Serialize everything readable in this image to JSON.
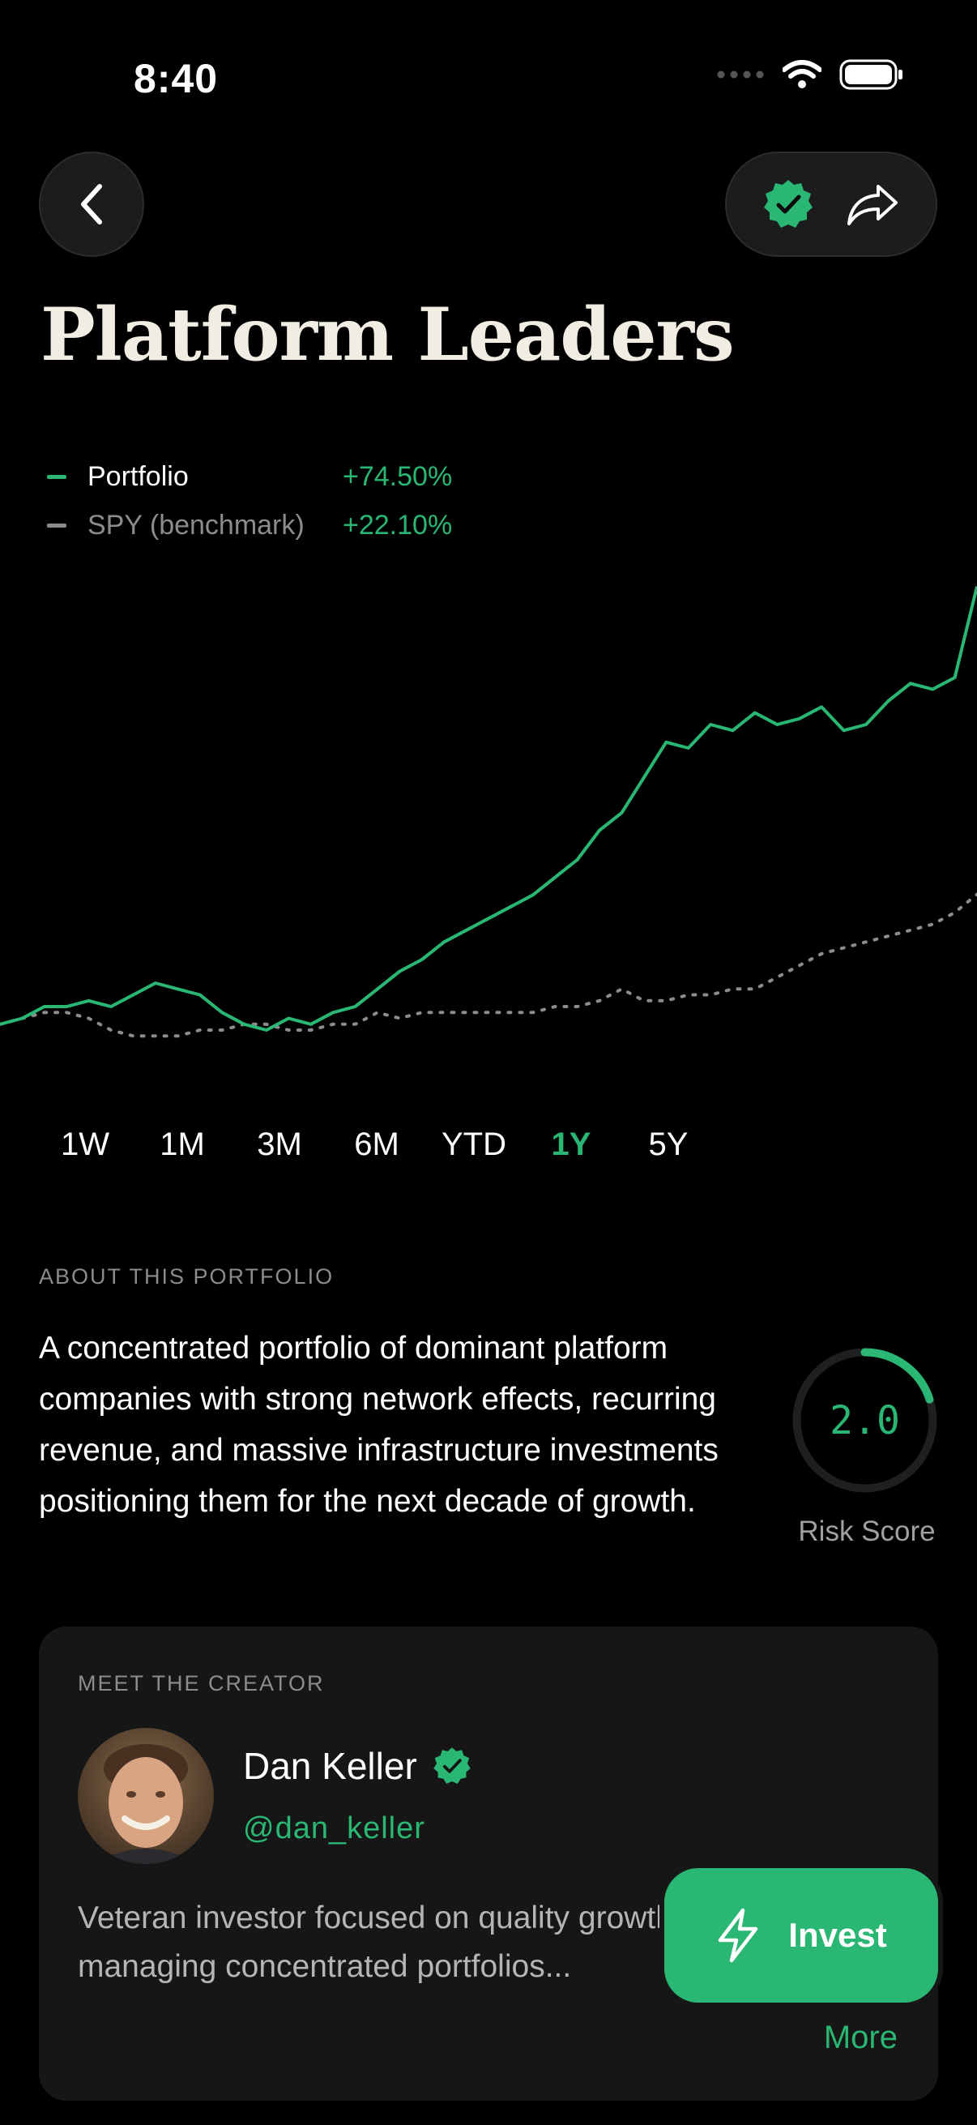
{
  "status": {
    "time": "8:40"
  },
  "header": {
    "back_icon": "chevron-left-icon",
    "verified_icon": "verified-badge-icon",
    "share_icon": "share-icon"
  },
  "page_title": "Platform Leaders",
  "legend": [
    {
      "name": "Portfolio",
      "value": "+74.50%",
      "color": "#2ab673"
    },
    {
      "name": "SPY (benchmark)",
      "value": "+22.10%",
      "color": "#8c8c8e"
    }
  ],
  "chart_data": {
    "type": "line",
    "series": [
      {
        "name": "Portfolio",
        "color": "#2ab673",
        "values": [
          0,
          1,
          3,
          3,
          4,
          3,
          5,
          7,
          6,
          5,
          2,
          0,
          -1,
          1,
          0,
          2,
          3,
          6,
          9,
          11,
          14,
          16,
          18,
          20,
          22,
          25,
          28,
          33,
          36,
          42,
          48,
          47,
          51,
          50,
          53,
          51,
          52,
          54,
          50,
          51,
          55,
          58,
          57,
          59,
          74.5
        ]
      },
      {
        "name": "SPY (benchmark)",
        "color": "#8c8c8e",
        "values": [
          0,
          1,
          2,
          2,
          1,
          -1,
          -2,
          -2,
          -2,
          -1,
          -1,
          0,
          0,
          -1,
          -1,
          0,
          0,
          2,
          1,
          2,
          2,
          2,
          2,
          2,
          2,
          3,
          3,
          4,
          6,
          4,
          4,
          5,
          5,
          6,
          6,
          8,
          10,
          12,
          13,
          14,
          15,
          16,
          17,
          19,
          22.1
        ]
      }
    ]
  },
  "ranges": [
    {
      "label": "1W",
      "active": false
    },
    {
      "label": "1M",
      "active": false
    },
    {
      "label": "3M",
      "active": false
    },
    {
      "label": "6M",
      "active": false
    },
    {
      "label": "YTD",
      "active": false
    },
    {
      "label": "1Y",
      "active": true
    },
    {
      "label": "5Y",
      "active": false
    }
  ],
  "about": {
    "section_label": "ABOUT THIS PORTFOLIO",
    "text": "A concentrated portfolio of dominant platform companies with strong network effects, recurring revenue, and massive infrastructure investments positioning them for the next decade of growth."
  },
  "risk": {
    "value": "2.0",
    "label": "Risk Score",
    "fraction": 0.2
  },
  "creator": {
    "section_label": "MEET THE CREATOR",
    "name": "Dan Keller",
    "handle": "@dan_keller",
    "bio": "Veteran investor focused on quality growth. 20+ years managing concentrated portfolios...",
    "more_label": "More"
  },
  "invest": {
    "label": "Invest",
    "icon": "lightning-icon"
  }
}
